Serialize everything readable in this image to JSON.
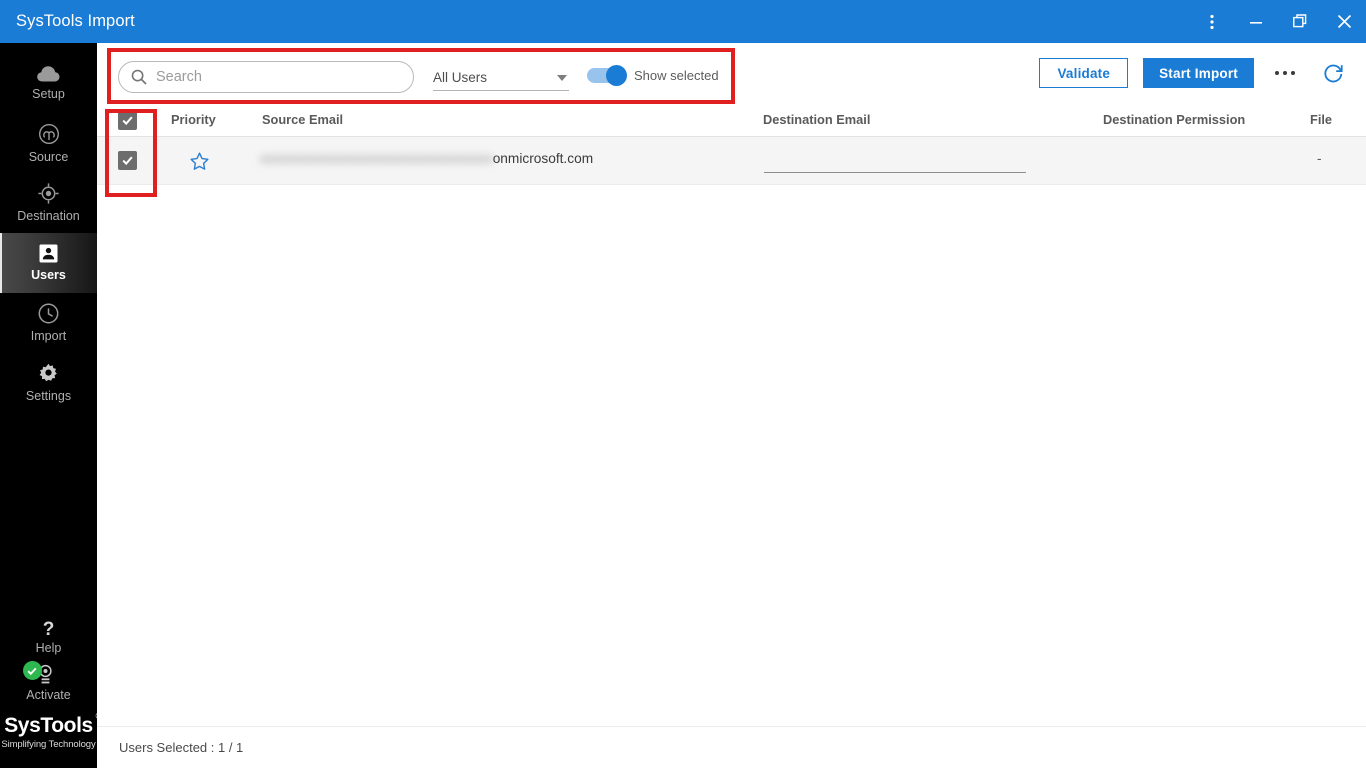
{
  "window": {
    "title": "SysTools Import",
    "controls": [
      {
        "name": "more-menu",
        "icon": "vertical-dots"
      },
      {
        "name": "minimize",
        "icon": "minimize"
      },
      {
        "name": "restore",
        "icon": "restore"
      },
      {
        "name": "close",
        "icon": "close"
      }
    ]
  },
  "colors": {
    "brand_blue": "#1a7cd4",
    "sidebar_bg": "#000000",
    "annotation_red": "#e02020",
    "row_bg": "#f5f5f5",
    "checkbox_gray": "#6d6d6d",
    "activate_green": "#2eb84f",
    "star_blue": "#2c7fd0"
  },
  "sidebar": {
    "items": [
      {
        "label": "Setup",
        "icon": "cloud-icon",
        "active": false
      },
      {
        "label": "Source",
        "icon": "signal-icon",
        "active": false
      },
      {
        "label": "Destination",
        "icon": "target-icon",
        "active": false
      },
      {
        "label": "Users",
        "icon": "user-icon",
        "active": true
      },
      {
        "label": "Import",
        "icon": "clock-icon",
        "active": false
      },
      {
        "label": "Settings",
        "icon": "gear-icon",
        "active": false
      }
    ],
    "bottom": [
      {
        "label": "Help",
        "icon": "question-mark-icon"
      },
      {
        "label": "Activate",
        "icon": "award-badge-icon",
        "status": "activated-check"
      }
    ],
    "brand": {
      "name": "SysTools",
      "registered": "®",
      "tagline": "Simplifying Technology"
    }
  },
  "toolbar": {
    "search": {
      "placeholder": "Search",
      "value": "",
      "icon": "search-icon"
    },
    "user_filter": {
      "selected": "All Users",
      "icon": "chevron-down-icon"
    },
    "show_selected": {
      "label": "Show selected",
      "on": true
    },
    "validate_label": "Validate",
    "start_import_label": "Start Import",
    "more_icon": "ellipsis-icon",
    "refresh_icon": "refresh-icon"
  },
  "table": {
    "select_all": true,
    "headers": {
      "priority": "Priority",
      "source_email": "Source Email",
      "destination_email": "Destination Email",
      "destination_permission": "Destination Permission",
      "file": "File"
    },
    "rows": [
      {
        "selected": true,
        "priority_icon": "star-outline-icon",
        "source_email_blurred": "xxxxxxxxxxxxxxxxxxxxxxxxxxxxxxxxxx",
        "source_email_visible": "onmicrosoft.com",
        "destination_email": "",
        "destination_permission": "",
        "file": "-"
      }
    ]
  },
  "status": {
    "text": "Users Selected : 1 / 1"
  },
  "annotations": [
    {
      "name": "toolbar-highlight",
      "color": "#e02020"
    },
    {
      "name": "checkbox-column-highlight",
      "color": "#e02020"
    }
  ]
}
